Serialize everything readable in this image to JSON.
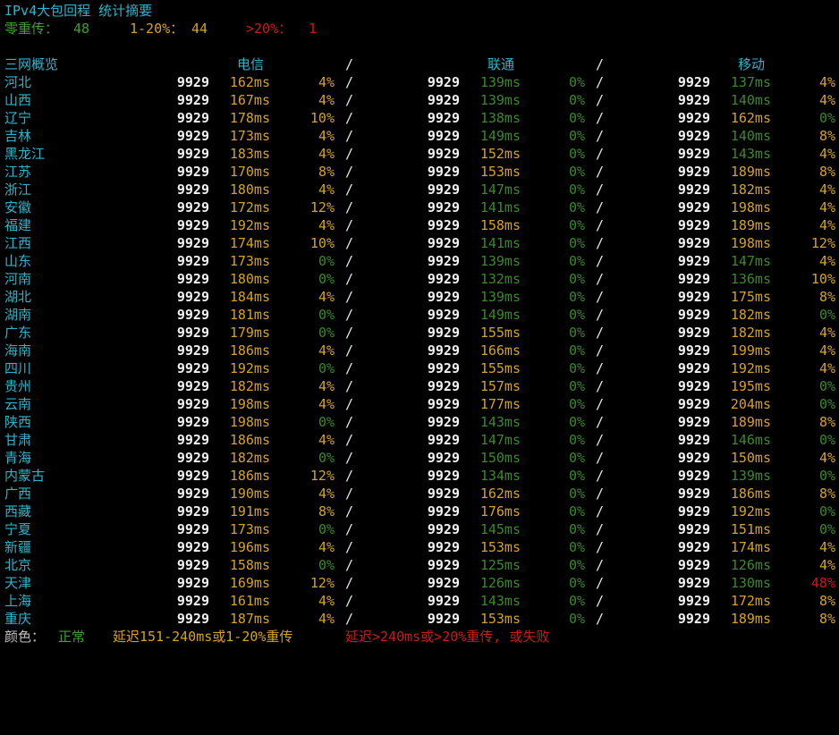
{
  "title": "IPv4大包回程 统计摘要",
  "summary": {
    "zero_label": "零重传：",
    "zero_value": "48",
    "mid_label": "1-20%：",
    "mid_value": "44",
    "high_label": ">20%：",
    "high_value": "1"
  },
  "table": {
    "region_header": "三网概览",
    "isp_headers": [
      "电信",
      "联通",
      "移动"
    ],
    "separator": "/",
    "rows": [
      {
        "region": "河北",
        "ct": [
          "9929",
          "162ms",
          "4%"
        ],
        "cu": [
          "9929",
          "139ms",
          "0%"
        ],
        "cm": [
          "9929",
          "137ms",
          "4%"
        ],
        "cls": [
          "y",
          "y",
          "g",
          "g",
          "g",
          "y"
        ]
      },
      {
        "region": "山西",
        "ct": [
          "9929",
          "167ms",
          "4%"
        ],
        "cu": [
          "9929",
          "139ms",
          "0%"
        ],
        "cm": [
          "9929",
          "140ms",
          "4%"
        ],
        "cls": [
          "y",
          "y",
          "g",
          "g",
          "g",
          "y"
        ]
      },
      {
        "region": "辽宁",
        "ct": [
          "9929",
          "178ms",
          "10%"
        ],
        "cu": [
          "9929",
          "138ms",
          "0%"
        ],
        "cm": [
          "9929",
          "162ms",
          "0%"
        ],
        "cls": [
          "y",
          "y",
          "g",
          "g",
          "y",
          "g"
        ]
      },
      {
        "region": "吉林",
        "ct": [
          "9929",
          "173ms",
          "4%"
        ],
        "cu": [
          "9929",
          "149ms",
          "0%"
        ],
        "cm": [
          "9929",
          "140ms",
          "8%"
        ],
        "cls": [
          "y",
          "y",
          "g",
          "g",
          "g",
          "y"
        ]
      },
      {
        "region": "黑龙江",
        "ct": [
          "9929",
          "183ms",
          "4%"
        ],
        "cu": [
          "9929",
          "152ms",
          "0%"
        ],
        "cm": [
          "9929",
          "143ms",
          "4%"
        ],
        "cls": [
          "y",
          "y",
          "y",
          "g",
          "g",
          "y"
        ]
      },
      {
        "region": "江苏",
        "ct": [
          "9929",
          "170ms",
          "8%"
        ],
        "cu": [
          "9929",
          "153ms",
          "0%"
        ],
        "cm": [
          "9929",
          "189ms",
          "8%"
        ],
        "cls": [
          "y",
          "y",
          "y",
          "g",
          "y",
          "y"
        ]
      },
      {
        "region": "浙江",
        "ct": [
          "9929",
          "180ms",
          "4%"
        ],
        "cu": [
          "9929",
          "147ms",
          "0%"
        ],
        "cm": [
          "9929",
          "182ms",
          "4%"
        ],
        "cls": [
          "y",
          "y",
          "g",
          "g",
          "y",
          "y"
        ]
      },
      {
        "region": "安徽",
        "ct": [
          "9929",
          "172ms",
          "12%"
        ],
        "cu": [
          "9929",
          "141ms",
          "0%"
        ],
        "cm": [
          "9929",
          "198ms",
          "4%"
        ],
        "cls": [
          "y",
          "y",
          "g",
          "g",
          "y",
          "y"
        ]
      },
      {
        "region": "福建",
        "ct": [
          "9929",
          "192ms",
          "4%"
        ],
        "cu": [
          "9929",
          "158ms",
          "0%"
        ],
        "cm": [
          "9929",
          "189ms",
          "4%"
        ],
        "cls": [
          "y",
          "y",
          "y",
          "g",
          "y",
          "y"
        ]
      },
      {
        "region": "江西",
        "ct": [
          "9929",
          "174ms",
          "10%"
        ],
        "cu": [
          "9929",
          "141ms",
          "0%"
        ],
        "cm": [
          "9929",
          "198ms",
          "12%"
        ],
        "cls": [
          "y",
          "y",
          "g",
          "g",
          "y",
          "y"
        ]
      },
      {
        "region": "山东",
        "ct": [
          "9929",
          "173ms",
          "0%"
        ],
        "cu": [
          "9929",
          "139ms",
          "0%"
        ],
        "cm": [
          "9929",
          "147ms",
          "4%"
        ],
        "cls": [
          "y",
          "g",
          "g",
          "g",
          "g",
          "y"
        ]
      },
      {
        "region": "河南",
        "ct": [
          "9929",
          "180ms",
          "0%"
        ],
        "cu": [
          "9929",
          "132ms",
          "0%"
        ],
        "cm": [
          "9929",
          "136ms",
          "10%"
        ],
        "cls": [
          "y",
          "g",
          "g",
          "g",
          "g",
          "y"
        ]
      },
      {
        "region": "湖北",
        "ct": [
          "9929",
          "184ms",
          "4%"
        ],
        "cu": [
          "9929",
          "139ms",
          "0%"
        ],
        "cm": [
          "9929",
          "175ms",
          "8%"
        ],
        "cls": [
          "y",
          "y",
          "g",
          "g",
          "y",
          "y"
        ]
      },
      {
        "region": "湖南",
        "ct": [
          "9929",
          "181ms",
          "0%"
        ],
        "cu": [
          "9929",
          "149ms",
          "0%"
        ],
        "cm": [
          "9929",
          "182ms",
          "0%"
        ],
        "cls": [
          "y",
          "g",
          "g",
          "g",
          "y",
          "g"
        ]
      },
      {
        "region": "广东",
        "ct": [
          "9929",
          "179ms",
          "0%"
        ],
        "cu": [
          "9929",
          "155ms",
          "0%"
        ],
        "cm": [
          "9929",
          "182ms",
          "4%"
        ],
        "cls": [
          "y",
          "g",
          "y",
          "g",
          "y",
          "y"
        ]
      },
      {
        "region": "海南",
        "ct": [
          "9929",
          "186ms",
          "4%"
        ],
        "cu": [
          "9929",
          "166ms",
          "0%"
        ],
        "cm": [
          "9929",
          "199ms",
          "4%"
        ],
        "cls": [
          "y",
          "y",
          "y",
          "g",
          "y",
          "y"
        ]
      },
      {
        "region": "四川",
        "ct": [
          "9929",
          "192ms",
          "0%"
        ],
        "cu": [
          "9929",
          "155ms",
          "0%"
        ],
        "cm": [
          "9929",
          "192ms",
          "4%"
        ],
        "cls": [
          "y",
          "g",
          "y",
          "g",
          "y",
          "y"
        ]
      },
      {
        "region": "贵州",
        "ct": [
          "9929",
          "182ms",
          "4%"
        ],
        "cu": [
          "9929",
          "157ms",
          "0%"
        ],
        "cm": [
          "9929",
          "195ms",
          "0%"
        ],
        "cls": [
          "y",
          "y",
          "y",
          "g",
          "y",
          "g"
        ]
      },
      {
        "region": "云南",
        "ct": [
          "9929",
          "198ms",
          "4%"
        ],
        "cu": [
          "9929",
          "177ms",
          "0%"
        ],
        "cm": [
          "9929",
          "204ms",
          "0%"
        ],
        "cls": [
          "y",
          "y",
          "y",
          "g",
          "y",
          "g"
        ]
      },
      {
        "region": "陕西",
        "ct": [
          "9929",
          "198ms",
          "0%"
        ],
        "cu": [
          "9929",
          "143ms",
          "0%"
        ],
        "cm": [
          "9929",
          "189ms",
          "8%"
        ],
        "cls": [
          "y",
          "g",
          "g",
          "g",
          "y",
          "y"
        ]
      },
      {
        "region": "甘肃",
        "ct": [
          "9929",
          "186ms",
          "4%"
        ],
        "cu": [
          "9929",
          "147ms",
          "0%"
        ],
        "cm": [
          "9929",
          "146ms",
          "0%"
        ],
        "cls": [
          "y",
          "y",
          "g",
          "g",
          "g",
          "g"
        ]
      },
      {
        "region": "青海",
        "ct": [
          "9929",
          "182ms",
          "0%"
        ],
        "cu": [
          "9929",
          "150ms",
          "0%"
        ],
        "cm": [
          "9929",
          "150ms",
          "4%"
        ],
        "cls": [
          "y",
          "g",
          "g",
          "g",
          "y",
          "y"
        ]
      },
      {
        "region": "内蒙古",
        "ct": [
          "9929",
          "186ms",
          "12%"
        ],
        "cu": [
          "9929",
          "134ms",
          "0%"
        ],
        "cm": [
          "9929",
          "139ms",
          "0%"
        ],
        "cls": [
          "y",
          "y",
          "g",
          "g",
          "g",
          "g"
        ]
      },
      {
        "region": "广西",
        "ct": [
          "9929",
          "190ms",
          "4%"
        ],
        "cu": [
          "9929",
          "162ms",
          "0%"
        ],
        "cm": [
          "9929",
          "186ms",
          "8%"
        ],
        "cls": [
          "y",
          "y",
          "y",
          "g",
          "y",
          "y"
        ]
      },
      {
        "region": "西藏",
        "ct": [
          "9929",
          "191ms",
          "8%"
        ],
        "cu": [
          "9929",
          "176ms",
          "0%"
        ],
        "cm": [
          "9929",
          "192ms",
          "0%"
        ],
        "cls": [
          "y",
          "y",
          "y",
          "g",
          "y",
          "g"
        ]
      },
      {
        "region": "宁夏",
        "ct": [
          "9929",
          "173ms",
          "0%"
        ],
        "cu": [
          "9929",
          "145ms",
          "0%"
        ],
        "cm": [
          "9929",
          "151ms",
          "0%"
        ],
        "cls": [
          "y",
          "g",
          "g",
          "g",
          "y",
          "g"
        ]
      },
      {
        "region": "新疆",
        "ct": [
          "9929",
          "196ms",
          "4%"
        ],
        "cu": [
          "9929",
          "153ms",
          "0%"
        ],
        "cm": [
          "9929",
          "174ms",
          "4%"
        ],
        "cls": [
          "y",
          "y",
          "y",
          "g",
          "y",
          "y"
        ]
      },
      {
        "region": "北京",
        "ct": [
          "9929",
          "158ms",
          "0%"
        ],
        "cu": [
          "9929",
          "125ms",
          "0%"
        ],
        "cm": [
          "9929",
          "126ms",
          "4%"
        ],
        "cls": [
          "y",
          "g",
          "g",
          "g",
          "g",
          "y"
        ]
      },
      {
        "region": "天津",
        "ct": [
          "9929",
          "169ms",
          "12%"
        ],
        "cu": [
          "9929",
          "126ms",
          "0%"
        ],
        "cm": [
          "9929",
          "130ms",
          "48%"
        ],
        "cls": [
          "y",
          "y",
          "g",
          "g",
          "g",
          "r"
        ]
      },
      {
        "region": "上海",
        "ct": [
          "9929",
          "161ms",
          "4%"
        ],
        "cu": [
          "9929",
          "143ms",
          "0%"
        ],
        "cm": [
          "9929",
          "172ms",
          "8%"
        ],
        "cls": [
          "y",
          "y",
          "g",
          "g",
          "y",
          "y"
        ]
      },
      {
        "region": "重庆",
        "ct": [
          "9929",
          "187ms",
          "4%"
        ],
        "cu": [
          "9929",
          "153ms",
          "0%"
        ],
        "cm": [
          "9929",
          "189ms",
          "8%"
        ],
        "cls": [
          "y",
          "y",
          "y",
          "g",
          "y",
          "y"
        ]
      }
    ]
  },
  "legend": {
    "label": "颜色：",
    "normal": "正常",
    "warn": "延迟151-240ms或1-20%重传",
    "bad": "延迟>240ms或>20%重传, 或失败"
  }
}
